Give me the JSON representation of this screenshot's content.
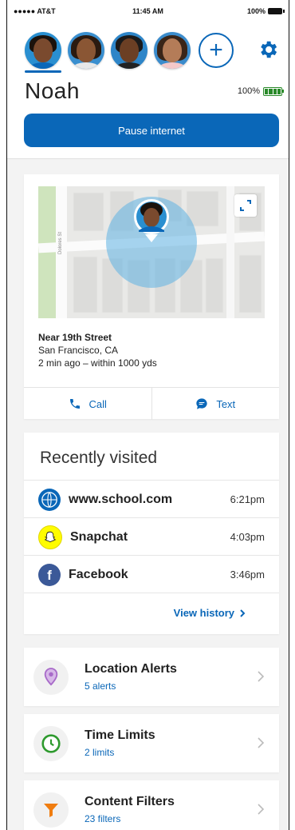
{
  "status_bar": {
    "carrier": "●●●●● AT&T",
    "time": "11:45 AM",
    "battery": "100%"
  },
  "header": {
    "child_name": "Noah",
    "battery_percent": "100%",
    "pause_button": "Pause internet",
    "add_profile_symbol": "+",
    "profiles": [
      {
        "name": "noah",
        "selected": true
      },
      {
        "name": "profile-2",
        "selected": false
      },
      {
        "name": "profile-3",
        "selected": false
      },
      {
        "name": "profile-4",
        "selected": false
      }
    ]
  },
  "location": {
    "place": "Near 19th Street",
    "city": "San Francisco, CA",
    "detail": "2 min ago – within 1000 yds",
    "call_label": "Call",
    "text_label": "Text",
    "street_label": "Dolores St"
  },
  "recently_visited": {
    "title": "Recently visited",
    "items": [
      {
        "name": "www.school.com",
        "time": "6:21pm",
        "icon": "globe-icon"
      },
      {
        "name": "Snapchat",
        "time": "4:03pm",
        "icon": "snapchat-icon"
      },
      {
        "name": "Facebook",
        "time": "3:46pm",
        "icon": "facebook-icon"
      }
    ],
    "view_history": "View history"
  },
  "features": [
    {
      "title": "Location Alerts",
      "subtitle": "5 alerts",
      "icon": "location-pin-icon",
      "color": "#a86ac9"
    },
    {
      "title": "Time Limits",
      "subtitle": "2 limits",
      "icon": "clock-icon",
      "color": "#2e9a2e"
    },
    {
      "title": "Content Filters",
      "subtitle": "23 filters",
      "icon": "filter-icon",
      "color": "#f07d10"
    }
  ],
  "colors": {
    "accent": "#0a67b8",
    "background": "#f3f3f3"
  }
}
